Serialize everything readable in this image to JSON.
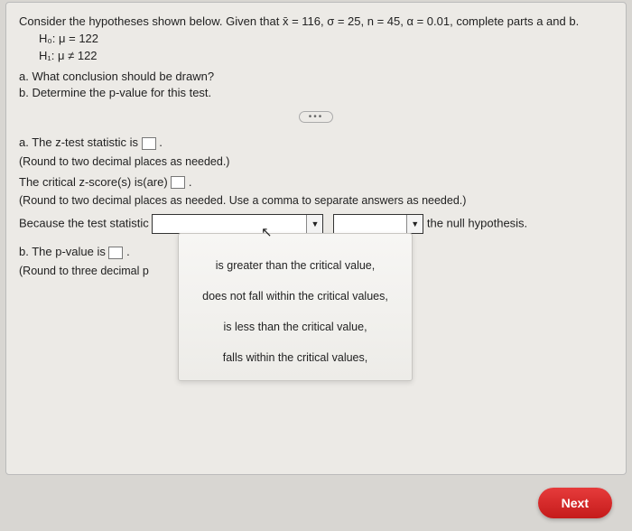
{
  "prompt": "Consider the hypotheses shown below. Given that x̄ = 116, σ = 25, n = 45, α = 0.01, complete parts a and b.",
  "h0": "H₀: μ = 122",
  "h1": "H₁: μ ≠ 122",
  "qa": "a. What conclusion should be drawn?",
  "qb": "b. Determine the p-value for this test.",
  "a_line1_pre": "a. The z-test statistic is ",
  "a_line1_post": ".",
  "round2": "(Round to two decimal places as needed.)",
  "critline_pre": "The critical z-score(s) is(are) ",
  "critline_post": ".",
  "round2b": "(Round to two decimal places as needed. Use a comma to separate answers as needed.)",
  "because_pre": "Because the test statistic ",
  "because_post": " the null hypothesis.",
  "b_line_pre": "b. The p-value is ",
  "b_line_post": ".",
  "round3": "(Round to three decimal p",
  "dropdown_options": [
    "is greater than the critical value,",
    "does not fall within the critical values,",
    "is less than the critical value,",
    "falls within the critical values,"
  ],
  "next_label": "Next",
  "dots": "•••"
}
